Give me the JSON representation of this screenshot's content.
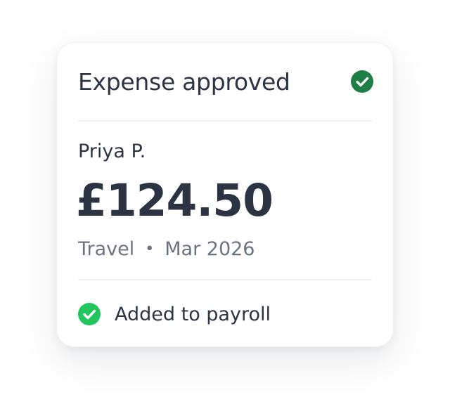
{
  "card": {
    "title": "Expense approved",
    "status_icon": "check-circle-icon",
    "employee_name": "Priya P.",
    "amount": "£124.50",
    "category": "Travel",
    "separator": "•",
    "period": "Mar 2026",
    "footer_icon": "check-circle-icon",
    "footer_text": "Added to payroll"
  },
  "colors": {
    "header_check": "#1e7f45",
    "footer_check": "#22c55e",
    "text_primary": "#2c3444",
    "text_secondary": "#6b7280",
    "divider": "#eef0f2"
  }
}
